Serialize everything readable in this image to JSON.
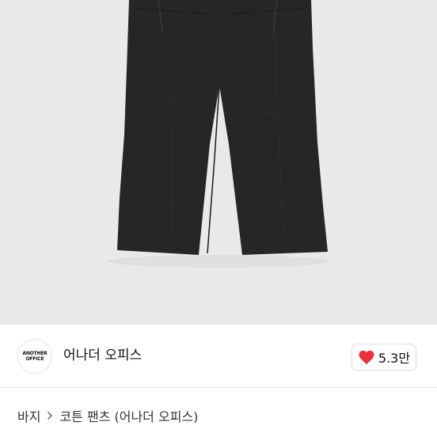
{
  "brand": {
    "logo_line1": "ANOTHER",
    "logo_line2": "OFFICE",
    "name": "어나더 오피스"
  },
  "likes": {
    "count": "5.3만",
    "icon": "heart-icon",
    "icon_color": "#e8323c"
  },
  "breadcrumb": {
    "category": "바지",
    "separator_icon": "chevron-right-icon",
    "product": "코튼 팬츠 (어나더 오피스)"
  },
  "colors": {
    "background": "#e9e9e9",
    "garment": "#262626"
  }
}
